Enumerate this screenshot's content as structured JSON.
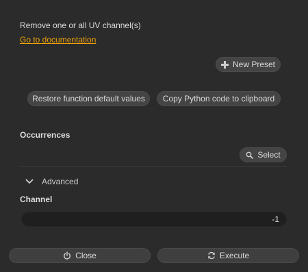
{
  "header": {
    "description": "Remove one or all UV channel(s)",
    "doc_link": "Go to documentation"
  },
  "toolbar": {
    "new_preset_label": "New Preset",
    "restore_label": "Restore function default values",
    "copy_python_label": "Copy Python code to clipboard"
  },
  "occurrences": {
    "title": "Occurrences",
    "select_label": "Select"
  },
  "advanced": {
    "label": "Advanced",
    "expanded": true
  },
  "channel": {
    "title": "Channel",
    "value": "-1"
  },
  "footer": {
    "close_label": "Close",
    "execute_label": "Execute"
  },
  "colors": {
    "background": "#2b2b2b",
    "accent_link": "#f0a30a",
    "button_bg": "#444444",
    "field_bg": "#1f1f1f"
  },
  "icons": {
    "new_preset": "plus-icon",
    "select": "search-icon",
    "advanced": "chevron-down-icon",
    "close": "power-icon",
    "execute": "refresh-icon"
  }
}
